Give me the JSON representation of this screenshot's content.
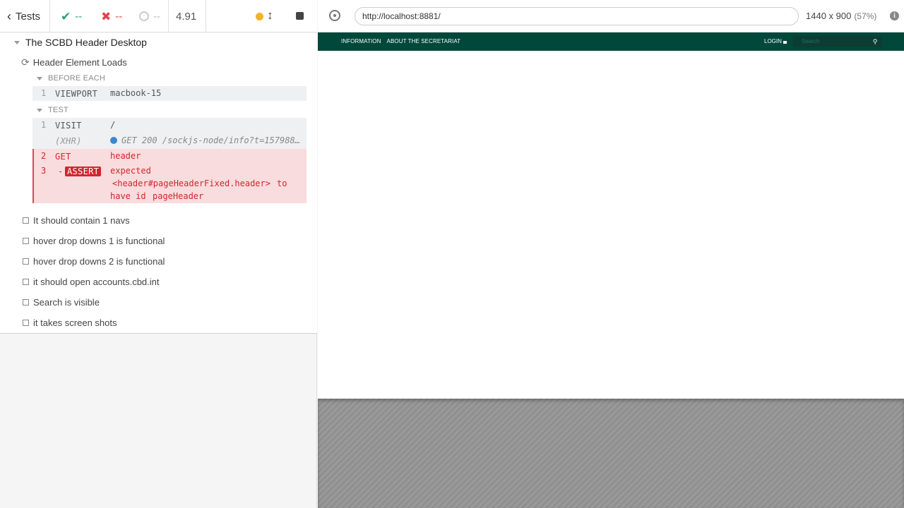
{
  "reporter": {
    "tests_label": "Tests",
    "passed": "--",
    "failed": "--",
    "pending": "--",
    "duration": "4.91",
    "suite": {
      "title": "The SCBD Header Desktop",
      "test_title": "Header Element Loads",
      "before_each_label": "BEFORE EACH",
      "test_label": "TEST",
      "before_each_commands": [
        {
          "num": "1",
          "name": "VIEWPORT",
          "message": "macbook-15"
        }
      ],
      "test_commands": [
        {
          "num": "1",
          "name": "VISIT",
          "message": "/"
        },
        {
          "num": "",
          "name": "(XHR)",
          "message": "GET 200 /sockjs-node/info?t=157988…"
        },
        {
          "num": "2",
          "name": "GET",
          "message": "header"
        },
        {
          "num": "3",
          "name": "ASSERT",
          "prefix": "-",
          "message_line1": "expected",
          "message_line2": "<header#pageHeaderFixed.header>",
          "message_line2b": "to",
          "message_line3a": "have id",
          "message_line3b": "pageHeader"
        }
      ],
      "other_tests": [
        "It should contain 1 navs",
        "hover drop downs 1 is functional",
        "hover drop downs 2 is functional",
        "it should open accounts.cbd.int",
        "Search is visible",
        "it takes screen shots"
      ]
    }
  },
  "aut": {
    "url": "http://localhost:8881/",
    "viewport": "1440 x 900",
    "scale": "(57%)",
    "site": {
      "nav_items": [
        "INFORMATION",
        "ABOUT THE SECRETARIAT"
      ],
      "login": "LOGIN",
      "search_placeholder": "Search"
    }
  },
  "colors": {
    "passed": "#27a17a",
    "failed": "#e0454e",
    "running": "#f3b22a",
    "site_header": "#00483a"
  }
}
